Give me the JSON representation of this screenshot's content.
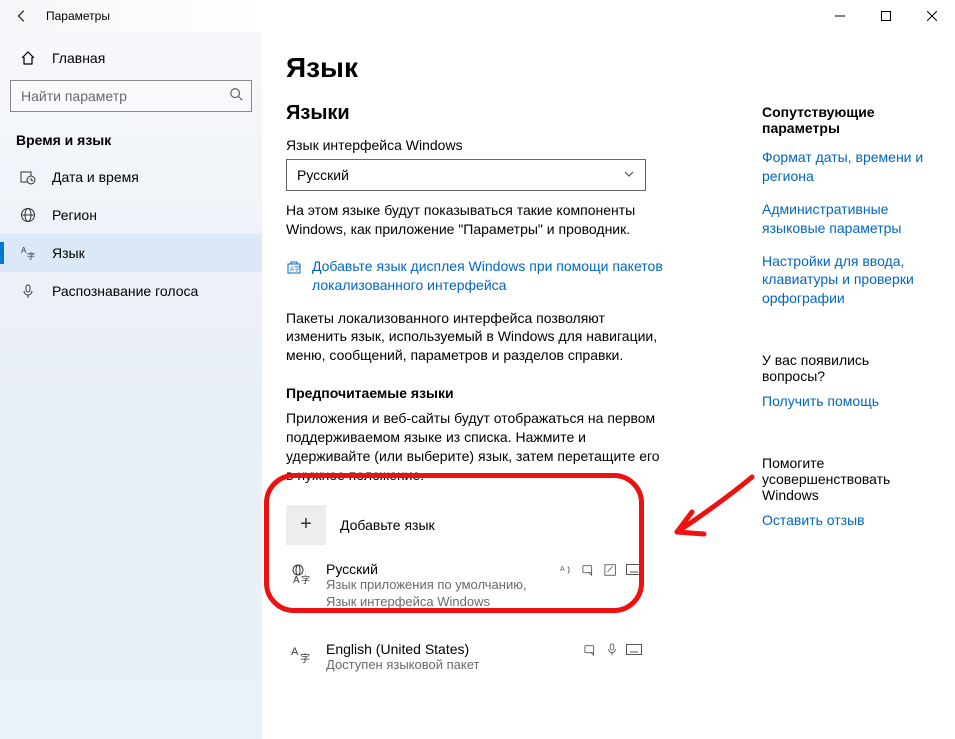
{
  "titlebar": {
    "app_name": "Параметры"
  },
  "sidebar": {
    "home": "Главная",
    "search_placeholder": "Найти параметр",
    "group": "Время и язык",
    "items": [
      {
        "label": "Дата и время"
      },
      {
        "label": "Регион"
      },
      {
        "label": "Язык"
      },
      {
        "label": "Распознавание голоса"
      }
    ]
  },
  "main": {
    "title": "Язык",
    "section_languages": "Языки",
    "ilabel": "Язык интерфейса Windows",
    "iselected": "Русский",
    "idesc": "На этом языке будут показываться такие компоненты Windows, как приложение \"Параметры\" и проводник.",
    "packs_link": "Добавьте язык дисплея Windows при помощи пакетов локализованного интерфейса",
    "packs_desc": "Пакеты локализованного интерфейса позволяют изменить язык, используемый в Windows для навигации, меню, сообщений, параметров и разделов справки.",
    "pref_heading": "Предпочитаемые языки",
    "pref_desc": "Приложения и веб-сайты будут отображаться на первом поддерживаемом языке из списка. Нажмите и удерживайте (или выберите) язык, затем перетащите его в нужное положение.",
    "add_label": "Добавьте язык",
    "langs": [
      {
        "name": "Русский",
        "sub": "Язык приложения по умолчанию, Язык интерфейса Windows"
      },
      {
        "name": "English (United States)",
        "sub": "Доступен языковой пакет"
      }
    ]
  },
  "right": {
    "related_heading": "Сопутствующие параметры",
    "link_date": "Формат даты, времени и региона",
    "link_admin": "Административные языковые параметры",
    "link_input": "Настройки для ввода, клавиатуры и проверки орфографии",
    "q_heading": "У вас появились вопросы?",
    "q_link": "Получить помощь",
    "f_heading": "Помогите усовершенствовать Windows",
    "f_link": "Оставить отзыв"
  }
}
